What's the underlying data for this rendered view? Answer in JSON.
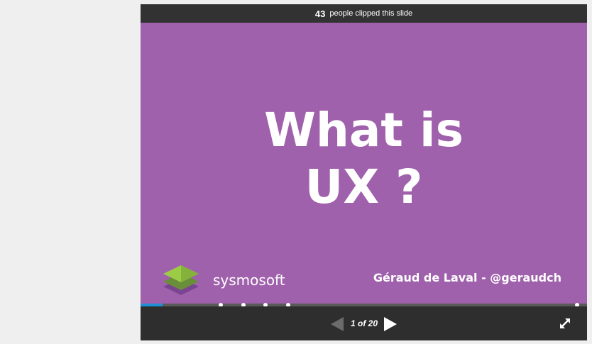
{
  "clip_bar": {
    "count": "43",
    "text": "people clipped this slide"
  },
  "slide": {
    "title_line1": "What is",
    "title_line2": "UX ?",
    "logo_text": "sysmosoft",
    "author": "Géraud de Laval  - @geraudch",
    "background": "#a061ac"
  },
  "progress": {
    "current": 1,
    "total": 20,
    "fill_color": "#1f8fd6",
    "bookmark_slides": [
      5,
      6,
      7,
      8,
      20
    ]
  },
  "controls": {
    "page_indicator": "1 of 20",
    "prev_icon": "triangle-left",
    "next_icon": "triangle-right",
    "fullscreen_icon": "expand-arrows"
  }
}
